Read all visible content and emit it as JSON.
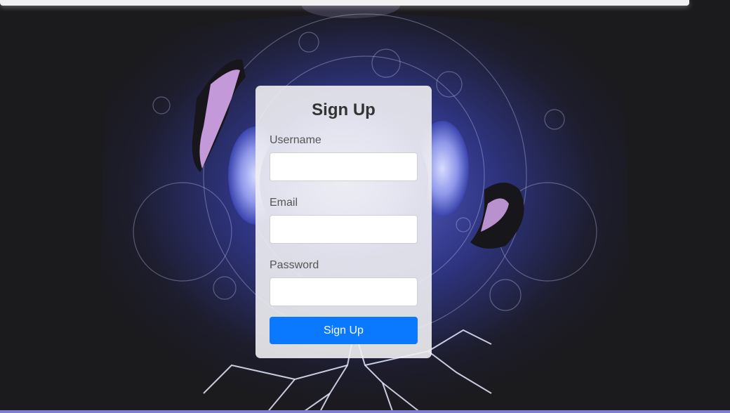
{
  "form": {
    "title": "Sign Up",
    "fields": [
      {
        "label": "Username",
        "value": "",
        "placeholder": ""
      },
      {
        "label": "Email",
        "value": "",
        "placeholder": ""
      },
      {
        "label": "Password",
        "value": "",
        "placeholder": ""
      }
    ],
    "submit_label": "Sign Up"
  },
  "colors": {
    "accent": "#0a78ff",
    "card_background": "#f0f0f2",
    "page_background": "#1b1a1d",
    "artwork_glow": "#3b45a8"
  },
  "icons": [
    "background-artwork"
  ]
}
